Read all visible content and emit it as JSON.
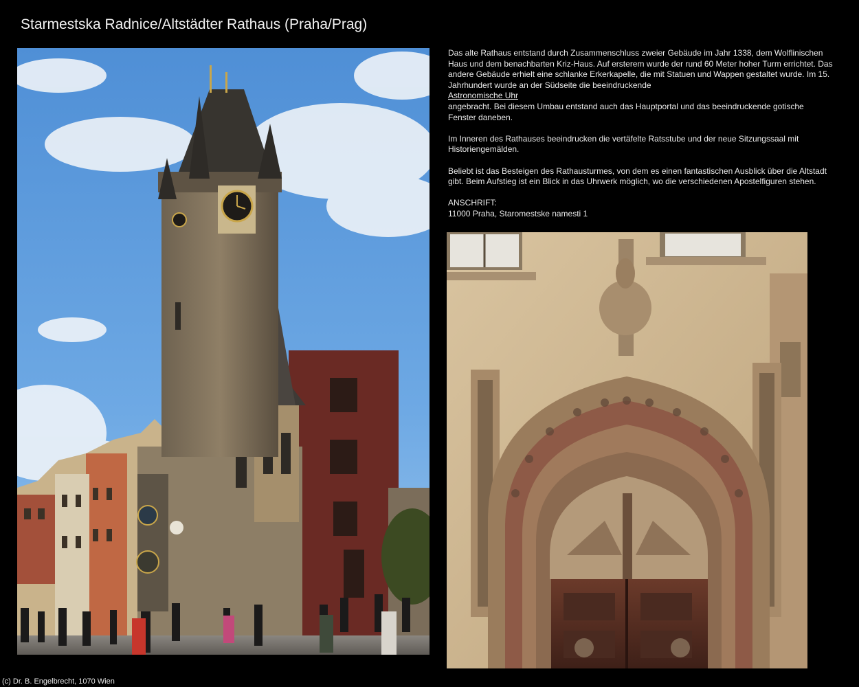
{
  "page": {
    "title": "Starmestska Radnice/Altstädter Rathaus (Praha/Prag)"
  },
  "description": {
    "p1_before_link": "Das alte Rathaus entstand durch Zusammenschluss zweier Gebäude im Jahr 1338, dem Wolflinischen Haus und dem benachbarten Kriz-Haus. Auf ersterem wurde der rund 60 Meter hoher Turm errichtet. Das andere Gebäude erhielt eine schlanke Erkerkapelle, die mit Statuen und Wappen gestaltet wurde. Im 15. Jahrhundert wurde an der Südseite die beeindruckende",
    "p1_link": "Astronomische Uhr",
    "p1_after_link": "angebracht. Bei diesem Umbau entstand auch das Hauptportal und das beeindruckende gotische Fenster daneben.",
    "p2": "Im Inneren des Rathauses beeindrucken die vertäfelte Ratsstube und der neue Sitzungssaal mit Historiengemälden.",
    "p3": "Beliebt ist das Besteigen des Rathausturmes, von dem es einen fantastischen Ausblick über die Altstadt gibt. Beim Aufstieg ist ein Blick in das Uhrwerk möglich, wo die verschiedenen Apostelfiguren stehen.",
    "address_label": "ANSCHRIFT:",
    "address": "11000 Praha, Staromestske namesti 1"
  },
  "photos": {
    "tower": "old-town-hall-tower-photo",
    "portal": "gothic-portal-photo"
  },
  "footer": {
    "copyright": "(c) Dr. B. Engelbrecht, 1070 Wien"
  }
}
